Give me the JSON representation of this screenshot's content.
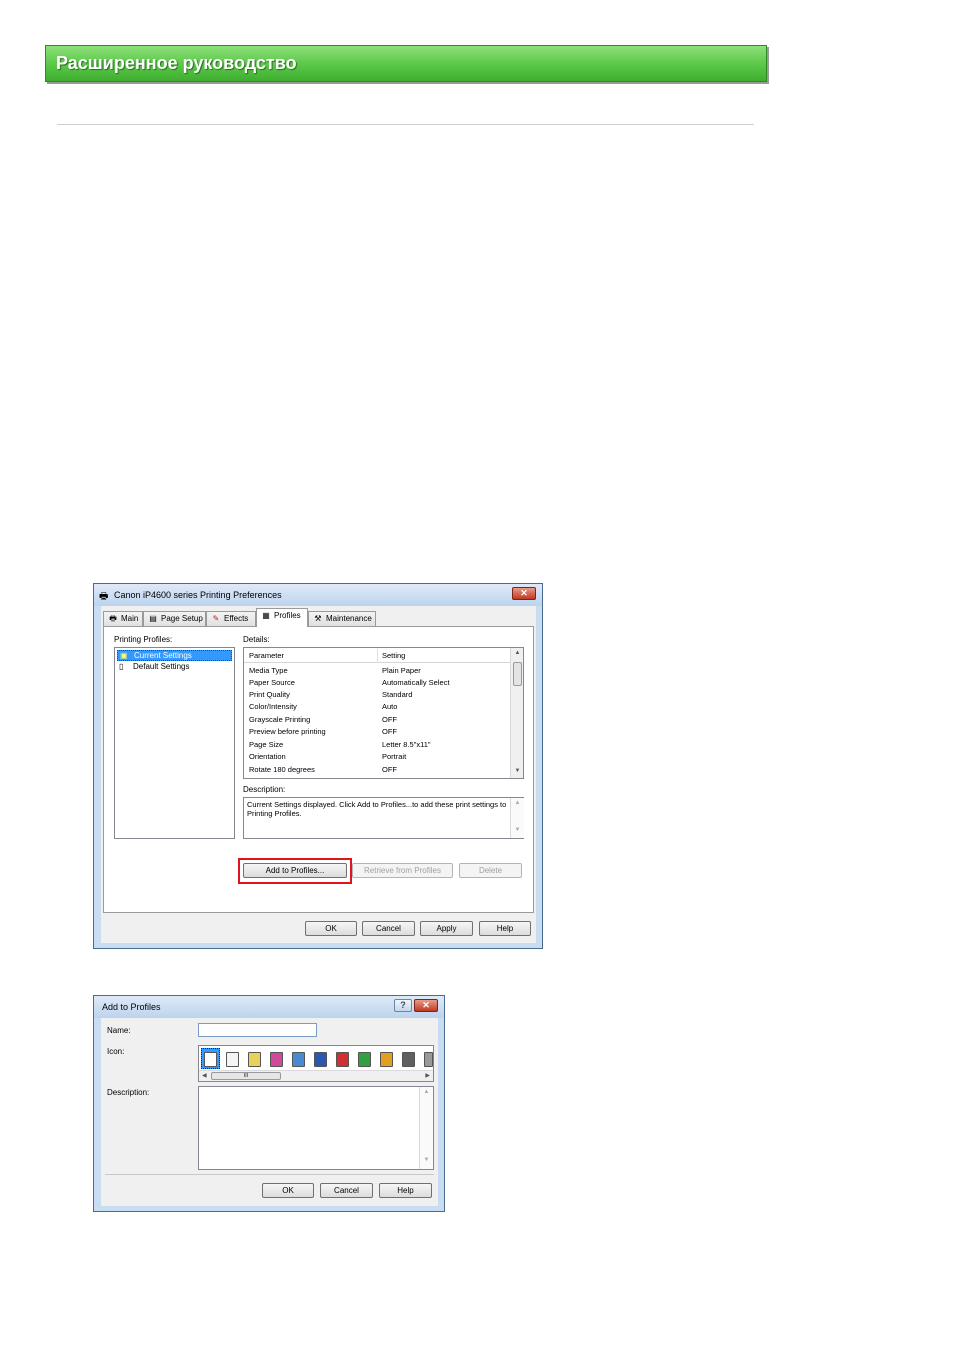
{
  "header": {
    "title": "Расширенное руководство"
  },
  "prefs": {
    "window_title": "Canon iP4600 series Printing Preferences",
    "close": "✕",
    "tabs": [
      {
        "label": "Main",
        "icon": "printer-icon"
      },
      {
        "label": "Page Setup",
        "icon": "page-setup-icon"
      },
      {
        "label": "Effects",
        "icon": "effects-icon"
      },
      {
        "label": "Profiles",
        "icon": "profiles-icon"
      },
      {
        "label": "Maintenance",
        "icon": "maintenance-icon"
      }
    ],
    "printing_profiles_label": "Printing Profiles:",
    "profiles": [
      "Current Settings",
      "Default Settings"
    ],
    "details_label": "Details:",
    "details_headers": [
      "Parameter",
      "Setting"
    ],
    "details_rows": [
      [
        "Media Type",
        "Plain Paper"
      ],
      [
        "Paper Source",
        "Automatically Select"
      ],
      [
        "Print Quality",
        "Standard"
      ],
      [
        "Color/Intensity",
        "Auto"
      ],
      [
        "Grayscale Printing",
        "OFF"
      ],
      [
        "Preview before printing",
        "OFF"
      ],
      [
        "Page Size",
        "Letter 8.5\"x11\""
      ],
      [
        "Orientation",
        "Portrait"
      ],
      [
        "Rotate 180 degrees",
        "OFF"
      ]
    ],
    "description_label": "Description:",
    "description_text": "Current Settings displayed. Click Add to Profiles...to add these print settings to Printing Profiles.",
    "buttons": {
      "add": "Add to Profiles...",
      "retrieve": "Retrieve from Profiles",
      "delete": "Delete",
      "ok": "OK",
      "cancel": "Cancel",
      "apply": "Apply",
      "help": "Help"
    }
  },
  "add_dialog": {
    "title": "Add to Profiles",
    "help": "?",
    "close": "✕",
    "name_label": "Name:",
    "name_value": "",
    "icon_label": "Icon:",
    "description_label": "Description:",
    "description_value": "",
    "scroll_thumb": "III",
    "buttons": {
      "ok": "OK",
      "cancel": "Cancel",
      "help": "Help"
    }
  }
}
